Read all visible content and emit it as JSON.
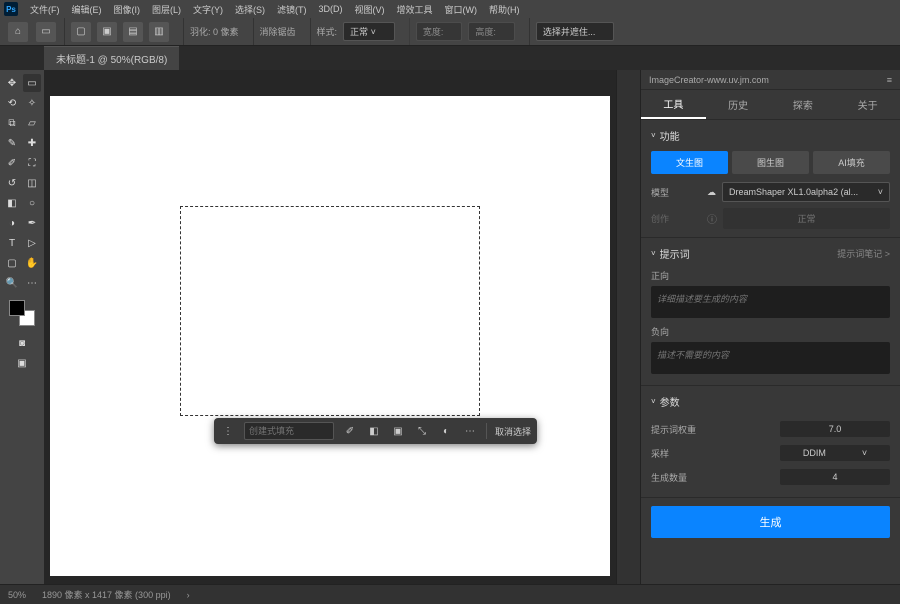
{
  "menu": [
    "文件(F)",
    "编辑(E)",
    "图像(I)",
    "图层(L)",
    "文字(Y)",
    "选择(S)",
    "滤镜(T)",
    "3D(D)",
    "视图(V)",
    "增效工具",
    "窗口(W)",
    "帮助(H)"
  ],
  "toolbar2": {
    "feather_label": "羽化: 0 像素",
    "mode_label": "样式:",
    "mode_value": "正常",
    "extra": "选择并遮住..."
  },
  "tab": "未标题-1 @ 50%(RGB/8)",
  "context": {
    "placeholder": "创建式填充",
    "cancel": "取消选择"
  },
  "panel": {
    "title": "ImageCreator-www.uv.jm.com",
    "tabs": [
      "工具",
      "历史",
      "探索",
      "关于"
    ],
    "section_function": "功能",
    "modes": [
      "文生图",
      "图生图",
      "AI填充"
    ],
    "model_label": "模型",
    "model_value": "DreamShaper XL1.0alpha2 (al...",
    "disabled_label": "创作",
    "disabled_btn": "正常",
    "section_prompt": "提示词",
    "prompt_hint": "提示词笔记 >",
    "pos_label": "正向",
    "pos_placeholder": "详细描述要生成的内容",
    "neg_label": "负向",
    "neg_placeholder": "描述不需要的内容",
    "section_params": "参数",
    "p1_label": "提示词权重",
    "p1_value": "7.0",
    "p2_label": "采样",
    "p2_value": "DDIM",
    "p3_label": "生成数量",
    "p3_value": "4",
    "generate": "生成"
  },
  "status": {
    "zoom": "50%",
    "dims": "1890 像素 x 1417 像素 (300 ppi)"
  }
}
